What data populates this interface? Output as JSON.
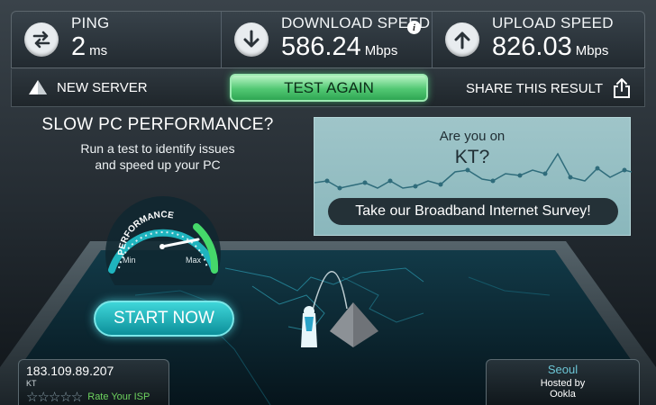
{
  "stats": {
    "ping": {
      "label": "PING",
      "value": "2",
      "unit": "ms"
    },
    "download": {
      "label": "DOWNLOAD SPEED",
      "value": "586.24",
      "unit": "Mbps"
    },
    "upload": {
      "label": "UPLOAD SPEED",
      "value": "826.03",
      "unit": "Mbps"
    }
  },
  "actions": {
    "new_server": "NEW SERVER",
    "test_again": "TEST AGAIN",
    "share": "SHARE THIS RESULT"
  },
  "promo": {
    "title": "SLOW PC PERFORMANCE?",
    "line1": "Run a test to identify issues",
    "line2": "and speed up your PC",
    "gauge_label": "PERFORMANCE",
    "gauge_min": "Min",
    "gauge_max": "Max",
    "start_button": "START NOW"
  },
  "survey": {
    "question": "Are you on",
    "isp": "KT?",
    "button": "Take our Broadband Internet Survey!"
  },
  "client": {
    "ip": "183.109.89.207",
    "isp": "KT",
    "stars": "☆☆☆☆☆",
    "rating": 0,
    "rate_label": "Rate Your ISP"
  },
  "server": {
    "city": "Seoul",
    "hosted_by": "Hosted by",
    "host": "Ookla"
  },
  "colors": {
    "accent_green": "#52c873",
    "accent_teal": "#1fb4be",
    "survey_bg": "#9fc5c9",
    "rate_green": "#6ed35f"
  },
  "icons": {
    "ping": "arrows-exchange-icon",
    "download": "arrow-down-icon",
    "upload": "arrow-up-icon",
    "info": "info-icon",
    "new_server": "triangle-icon",
    "share": "share-icon",
    "server_marker": "pyramid-marker-icon",
    "client_marker": "person-marker-icon"
  }
}
